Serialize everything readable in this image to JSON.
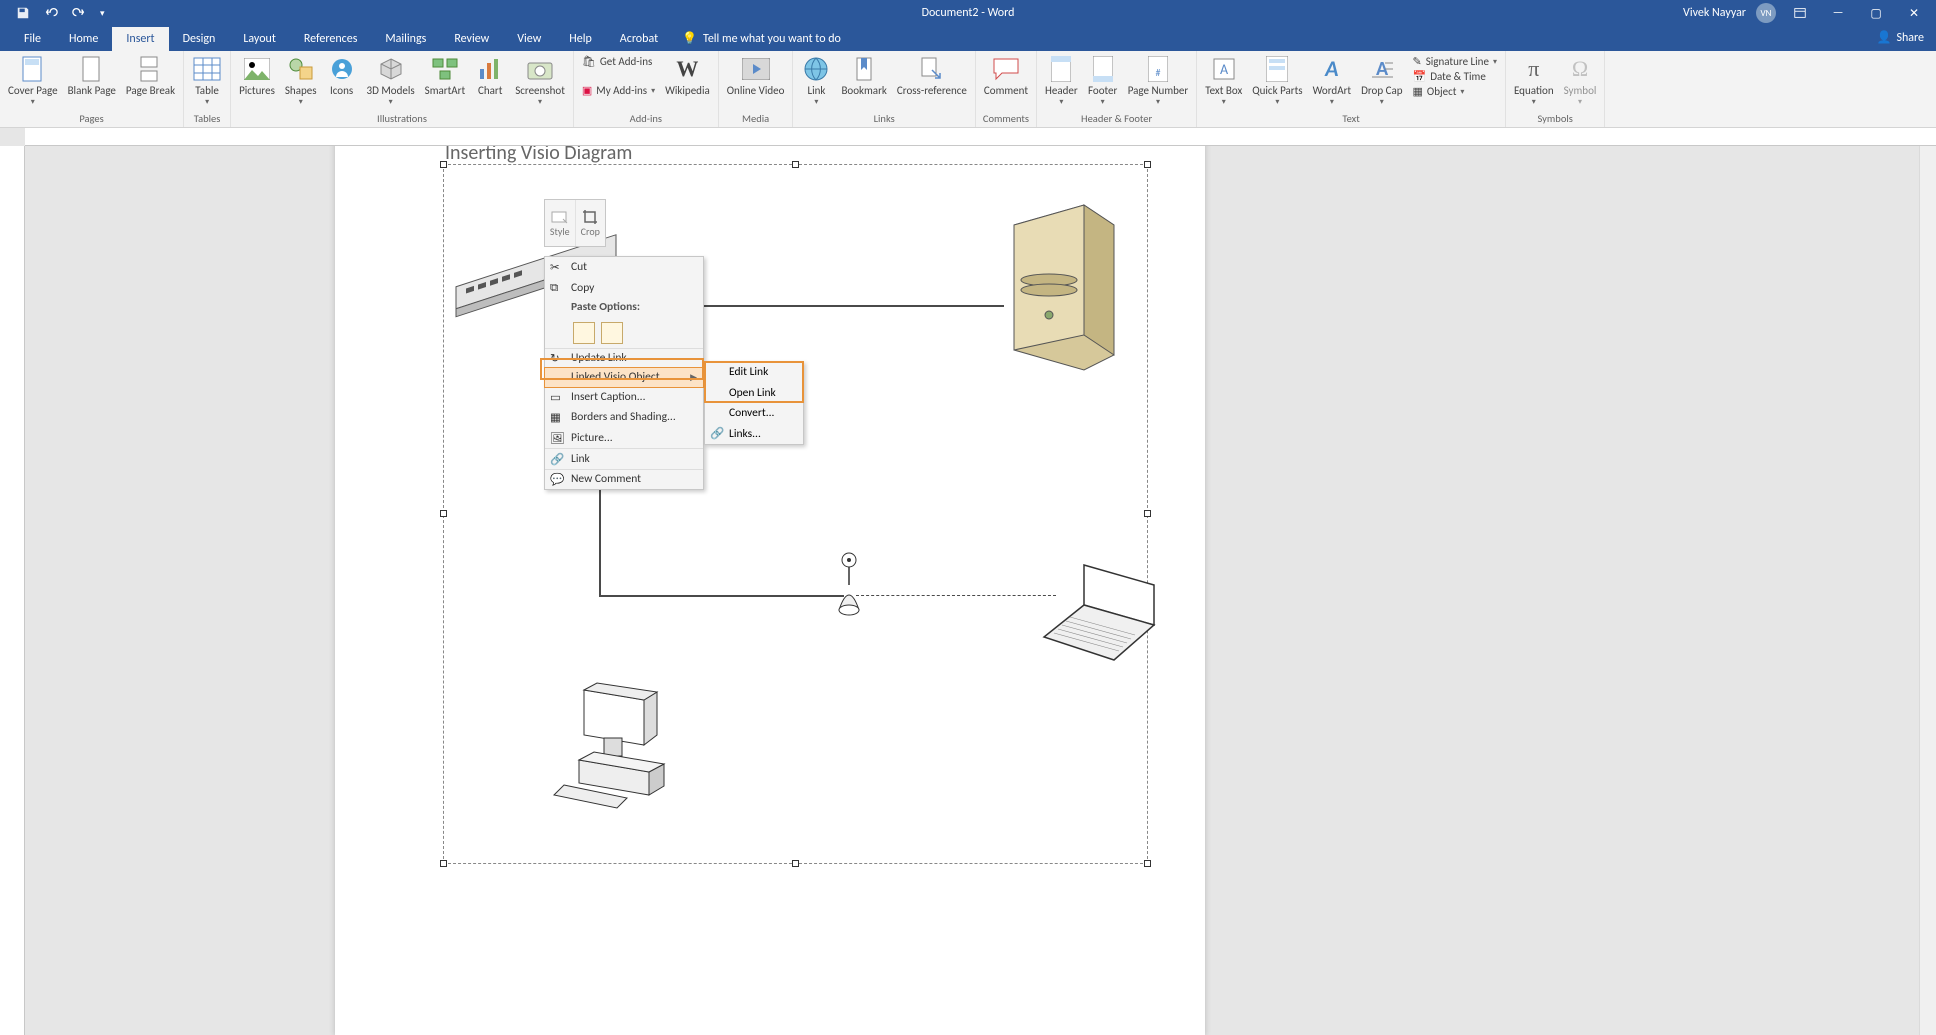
{
  "title": "Document2 - Word",
  "user": "Vivek Nayyar",
  "avatar": "VN",
  "share": "Share",
  "tabs": {
    "file": "File",
    "home": "Home",
    "insert": "Insert",
    "design": "Design",
    "layout": "Layout",
    "references": "References",
    "mailings": "Mailings",
    "review": "Review",
    "view": "View",
    "help": "Help",
    "acrobat": "Acrobat",
    "tellme": "Tell me what you want to do"
  },
  "ribbon": {
    "pages": {
      "label": "Pages",
      "cover": "Cover Page",
      "blank": "Blank Page",
      "break": "Page Break"
    },
    "tables": {
      "label": "Tables",
      "table": "Table"
    },
    "illus": {
      "label": "Illustrations",
      "pictures": "Pictures",
      "shapes": "Shapes",
      "icons": "Icons",
      "models": "3D Models",
      "smartart": "SmartArt",
      "chart": "Chart",
      "screenshot": "Screenshot"
    },
    "addins": {
      "label": "Add-ins",
      "get": "Get Add-ins",
      "my": "My Add-ins",
      "wiki": "Wikipedia"
    },
    "media": {
      "label": "Media",
      "video": "Online Video"
    },
    "links": {
      "label": "Links",
      "link": "Link",
      "bookmark": "Bookmark",
      "cross": "Cross-reference"
    },
    "comments": {
      "label": "Comments",
      "comment": "Comment"
    },
    "hf": {
      "label": "Header & Footer",
      "header": "Header",
      "footer": "Footer",
      "page": "Page Number"
    },
    "text": {
      "label": "Text",
      "textbox": "Text Box",
      "quick": "Quick Parts",
      "wordart": "WordArt",
      "drop": "Drop Cap",
      "sig": "Signature Line",
      "date": "Date & Time",
      "obj": "Object"
    },
    "symbols": {
      "label": "Symbols",
      "eq": "Equation",
      "sym": "Symbol"
    }
  },
  "doc": {
    "heading": "Inserting Visio Diagram"
  },
  "minitool": {
    "style": "Style",
    "crop": "Crop"
  },
  "ctx": {
    "cut": "Cut",
    "copy": "Copy",
    "pasteLbl": "Paste Options:",
    "update": "Update Link",
    "linked": "Linked Visio Object",
    "caption": "Insert Caption...",
    "borders": "Borders and Shading...",
    "picture": "Picture...",
    "link": "Link",
    "comment": "New Comment"
  },
  "submenu": {
    "edit": "Edit  Link",
    "open": "Open  Link",
    "convert": "Convert...",
    "links": "Links..."
  }
}
